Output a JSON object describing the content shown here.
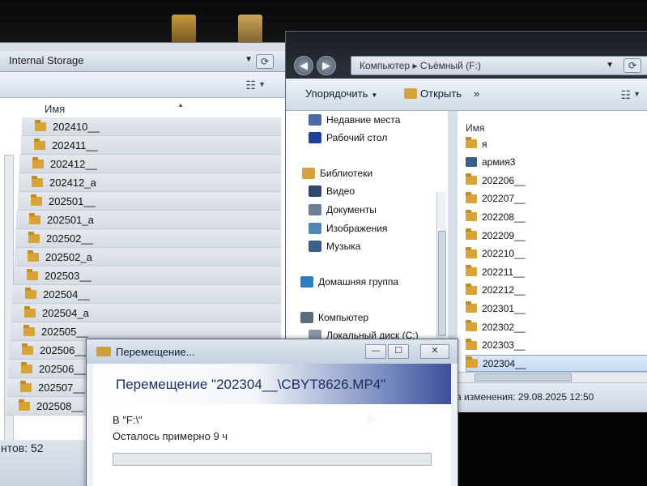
{
  "left_window": {
    "breadcrumb": "Internal Storage",
    "column_name": "Имя",
    "folders": [
      "202410__",
      "202411__",
      "202412__",
      "202412_a",
      "202501__",
      "202501_a",
      "202502__",
      "202502_a",
      "202503__",
      "202504__",
      "202504_a",
      "202505__",
      "202506__",
      "202506__",
      "202507__",
      "202508__"
    ],
    "status": "нтов: 52"
  },
  "right_window": {
    "breadcrumb": "Компьютер ▸ Съёмный (F:)",
    "toolbar": {
      "organize_label": "Упорядочить",
      "open_label": "Открыть",
      "more_label": "»"
    },
    "nav_items": [
      {
        "label": "Недавние места",
        "icon": "recent-places-icon",
        "color": "#4a6aa5"
      },
      {
        "label": "Рабочий стол",
        "icon": "desktop-icon",
        "color": "#1f3f9a"
      },
      {
        "label": "Библиотеки",
        "icon": "libraries-icon",
        "color": "#d6a23b"
      },
      {
        "label": "Видео",
        "icon": "video-icon",
        "color": "#31486e"
      },
      {
        "label": "Документы",
        "icon": "documents-icon",
        "color": "#6c7f98"
      },
      {
        "label": "Изображения",
        "icon": "pictures-icon",
        "color": "#4e86b4"
      },
      {
        "label": "Музыка",
        "icon": "music-icon",
        "color": "#3a5f8a"
      },
      {
        "label": "Домашняя группа",
        "icon": "homegroup-icon",
        "color": "#2f7fc0"
      },
      {
        "label": "Компьютер",
        "icon": "computer-icon",
        "color": "#5b6b80"
      },
      {
        "label": "Локальный диск (C:)",
        "icon": "local-disk-icon",
        "color": "#8a97a8"
      }
    ],
    "column_name": "Имя",
    "files": [
      {
        "label": "я",
        "type": "folder"
      },
      {
        "label": "армия3",
        "type": "video"
      },
      {
        "label": "202206__",
        "type": "folder"
      },
      {
        "label": "202207__",
        "type": "folder"
      },
      {
        "label": "202208__",
        "type": "folder"
      },
      {
        "label": "202209__",
        "type": "folder"
      },
      {
        "label": "202210__",
        "type": "folder"
      },
      {
        "label": "202211__",
        "type": "folder"
      },
      {
        "label": "202212__",
        "type": "folder"
      },
      {
        "label": "202301__",
        "type": "folder"
      },
      {
        "label": "202302__",
        "type": "folder"
      },
      {
        "label": "202303__",
        "type": "folder"
      },
      {
        "label": "202304__",
        "type": "folder",
        "selected": true
      }
    ],
    "details": "а изменения: 29.08.2025 12:50"
  },
  "dialog": {
    "title": "Перемещение...",
    "heading": "Перемещение \"202304__\\CBYT8626.MP4\"",
    "destination": "В \"F:\\\"",
    "time_left": "Осталось примерно 9 ч",
    "progress_fraction": 0.0,
    "buttons": {
      "minimize": "—",
      "maximize": "☐",
      "close": "✕"
    }
  }
}
